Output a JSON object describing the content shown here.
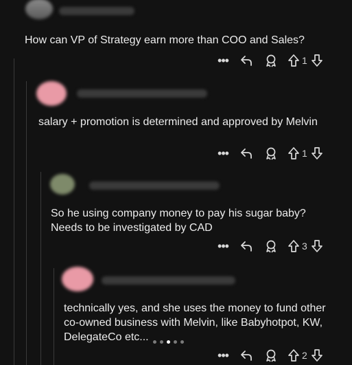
{
  "comments": [
    {
      "text": "How can VP of Strategy earn more than COO and Sales?",
      "votes": "1"
    },
    {
      "text": "salary + promotion is determined and approved by Melvin",
      "votes": "1"
    },
    {
      "text": "So he using company money to pay his sugar baby? Needs to be investigated by CAD",
      "votes": "3"
    },
    {
      "text": "technically yes, and she uses the money to fund other co-owned business with Melvin, like Babyhotpot, KW, DelegateCo etc...",
      "votes": "2"
    }
  ],
  "actions": {
    "more_label": "•••",
    "icons": [
      "more-icon",
      "reply-icon",
      "award-icon",
      "upvote-icon",
      "downvote-icon"
    ]
  },
  "pager": {
    "pages": 5,
    "active": 3
  },
  "colors": {
    "background": "#121212",
    "text": "#ececec",
    "thread_line": "#3a3a3a"
  }
}
